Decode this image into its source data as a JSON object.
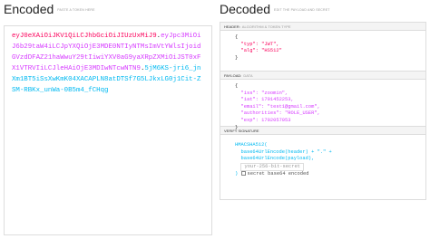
{
  "encoded": {
    "title": "Encoded",
    "subtitle": "PASTE A TOKEN HERE",
    "header_part": "eyJ0eXAiOiJKV1QiLCJhbGciOiJIUzUxMiJ9",
    "payload_part": "eyJpc3MiOiJ6b29taW4iLCJpYXQiOjE3MDE0NTIyNTMsImVtYWlsIjoidGVzdDFAZ21haWwuY29tIiwiYXV0aG9yaXRpZXMiOiJST0xFX1VTRVIiLCJleHAiOjE3MDIwNTcwNTN9",
    "signature_part": "5jM6KS-jri6_jnXm1BT5iSsXwKmK04XACAPLN8atDTSf7G5LJkxLG0j1Cit-ZSM-RBKx_unWa-0B5m4_fCHqg",
    "dot": "."
  },
  "decoded": {
    "title": "Decoded",
    "subtitle": "EDIT THE PAYLOAD AND SECRET",
    "header_section": {
      "label": "HEADER:",
      "sublabel": "ALGORITHM & TOKEN TYPE"
    },
    "payload_section": {
      "label": "PAYLOAD:",
      "sublabel": "DATA"
    },
    "signature_section": {
      "label": "VERIFY SIGNATURE"
    }
  },
  "header_json": {
    "open": "{",
    "typ_key": "\"typ\":",
    "typ_val": "\"JWT\",",
    "alg_key": "\"alg\":",
    "alg_val": "\"HS512\"",
    "close": "}"
  },
  "payload_json": {
    "open": "{",
    "iss_key": "\"iss\":",
    "iss_val": "\"zoomin\",",
    "iat_key": "\"iat\":",
    "iat_val": "1701452253,",
    "email_key": "\"email\":",
    "email_val": "\"test1@gmail.com\",",
    "auth_key": "\"authorities\":",
    "auth_val": "\"ROLE_USER\",",
    "exp_key": "\"exp\":",
    "exp_val": "1702057053",
    "close": "}"
  },
  "signature": {
    "line1": "HMACSHA512(",
    "line2": "base64UrlEncode(header) + \".\" +",
    "line3": "base64UrlEncode(payload),",
    "secret_placeholder": "your-256-bit-secret",
    "close": ")",
    "checkbox_label": "secret base64 encoded"
  }
}
